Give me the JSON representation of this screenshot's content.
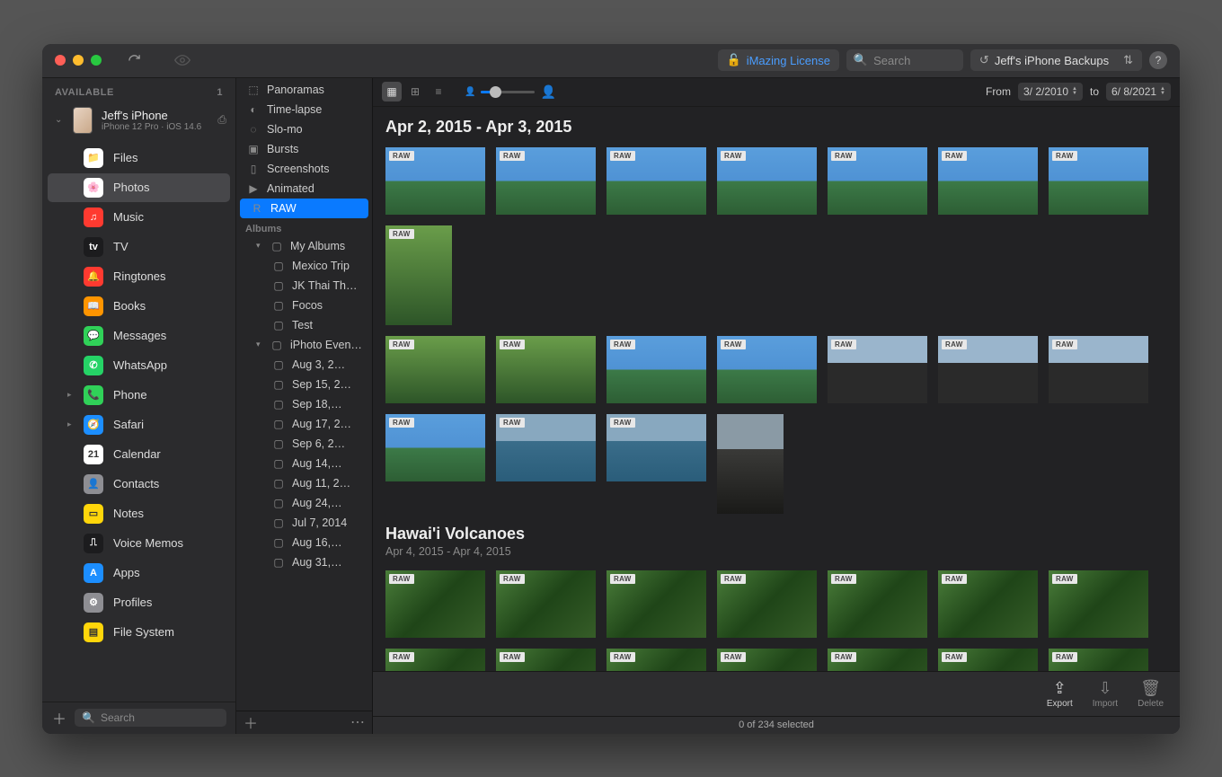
{
  "titlebar": {
    "license_label": "iMazing License",
    "search_placeholder": "Search",
    "backups_label": "Jeff's iPhone Backups",
    "help_label": "?"
  },
  "leftbar": {
    "header": "AVAILABLE",
    "count": "1",
    "device": {
      "name": "Jeff's iPhone",
      "sub": "iPhone 12 Pro · iOS 14.6"
    },
    "items": [
      {
        "label": "Files",
        "icon_bg": "#fff",
        "emoji": "📁",
        "sel": false
      },
      {
        "label": "Photos",
        "icon_bg": "#fff",
        "emoji": "🌸",
        "sel": true
      },
      {
        "label": "Music",
        "icon_bg": "#ff3a30",
        "emoji": "♫",
        "sel": false
      },
      {
        "label": "TV",
        "icon_bg": "#1c1c1e",
        "emoji": "tv",
        "sel": false
      },
      {
        "label": "Ringtones",
        "icon_bg": "#ff3a30",
        "emoji": "🔔",
        "sel": false
      },
      {
        "label": "Books",
        "icon_bg": "#ff9500",
        "emoji": "📖",
        "sel": false
      },
      {
        "label": "Messages",
        "icon_bg": "#30d158",
        "emoji": "💬",
        "sel": false
      },
      {
        "label": "WhatsApp",
        "icon_bg": "#25d366",
        "emoji": "✆",
        "sel": false
      },
      {
        "label": "Phone",
        "icon_bg": "#30d158",
        "emoji": "📞",
        "sel": false,
        "chev": true
      },
      {
        "label": "Safari",
        "icon_bg": "#1c8eff",
        "emoji": "🧭",
        "sel": false,
        "chev": true
      },
      {
        "label": "Calendar",
        "icon_bg": "#fff",
        "emoji": "21",
        "sel": false
      },
      {
        "label": "Contacts",
        "icon_bg": "#8e8e93",
        "emoji": "👤",
        "sel": false
      },
      {
        "label": "Notes",
        "icon_bg": "#ffd60a",
        "emoji": "▭",
        "sel": false
      },
      {
        "label": "Voice Memos",
        "icon_bg": "#1c1c1e",
        "emoji": "⎍",
        "sel": false
      },
      {
        "label": "Apps",
        "icon_bg": "#1c8eff",
        "emoji": "A",
        "sel": false
      },
      {
        "label": "Profiles",
        "icon_bg": "#8e8e93",
        "emoji": "⚙",
        "sel": false
      },
      {
        "label": "File System",
        "icon_bg": "#ffd60a",
        "emoji": "▤",
        "sel": false
      }
    ],
    "footer_search": "Search"
  },
  "midbar": {
    "smart": [
      {
        "label": "Panoramas",
        "ico": "⬚"
      },
      {
        "label": "Time-lapse",
        "ico": "◐"
      },
      {
        "label": "Slo-mo",
        "ico": "◌"
      },
      {
        "label": "Bursts",
        "ico": "▣"
      },
      {
        "label": "Screenshots",
        "ico": "▯"
      },
      {
        "label": "Animated",
        "ico": "▶"
      },
      {
        "label": "RAW",
        "ico": "R",
        "selected": true
      }
    ],
    "albums_header": "Albums",
    "albums": [
      {
        "label": "My Albums",
        "chev": "▾",
        "ico": "▢",
        "indent": 0
      },
      {
        "label": "Mexico Trip",
        "ico": "▢",
        "indent": 1
      },
      {
        "label": "JK Thai Th…",
        "ico": "▢",
        "indent": 1
      },
      {
        "label": "Focos",
        "ico": "▢",
        "indent": 1
      },
      {
        "label": "Test",
        "ico": "▢",
        "indent": 1
      },
      {
        "label": "iPhoto Even…",
        "chev": "▾",
        "ico": "▢",
        "indent": 0
      },
      {
        "label": "Aug 3, 2…",
        "ico": "▢",
        "indent": 1
      },
      {
        "label": "Sep 15, 2…",
        "ico": "▢",
        "indent": 1
      },
      {
        "label": "Sep 18,…",
        "ico": "▢",
        "indent": 1
      },
      {
        "label": "Aug 17, 2…",
        "ico": "▢",
        "indent": 1
      },
      {
        "label": "Sep 6, 2…",
        "ico": "▢",
        "indent": 1
      },
      {
        "label": "Aug 14,…",
        "ico": "▢",
        "indent": 1
      },
      {
        "label": "Aug 11, 2…",
        "ico": "▢",
        "indent": 1
      },
      {
        "label": "Aug 24,…",
        "ico": "▢",
        "indent": 1
      },
      {
        "label": "Jul 7, 2014",
        "ico": "▢",
        "indent": 1
      },
      {
        "label": "Aug 16,…",
        "ico": "▢",
        "indent": 1
      },
      {
        "label": "Aug 31,…",
        "ico": "▢",
        "indent": 1
      }
    ]
  },
  "main_toolbar": {
    "from_label": "From",
    "from_date": "3/  2/2010",
    "to_label": "to",
    "to_date": "6/  8/2021"
  },
  "sections": [
    {
      "title": "Apr 2, 2015 - Apr 3, 2015",
      "sub": "",
      "rows": [
        [
          {
            "c": "th-sky"
          },
          {
            "c": "th-sky"
          },
          {
            "c": "th-sky"
          },
          {
            "c": "th-sky"
          },
          {
            "c": "th-sky"
          },
          {
            "c": "th-sky"
          },
          {
            "c": "th-sky"
          },
          {
            "c": "th-green",
            "tall": true
          }
        ],
        [
          {
            "c": "th-green"
          },
          {
            "c": "th-green"
          },
          {
            "c": "th-sky"
          },
          {
            "c": "th-sky"
          },
          {
            "c": "th-car"
          },
          {
            "c": "th-car"
          },
          {
            "c": "th-car"
          }
        ],
        [
          {
            "c": "th-sky"
          },
          {
            "c": "th-sea"
          },
          {
            "c": "th-sea"
          },
          {
            "c": "th-dark",
            "tall": true,
            "noRaw": true
          }
        ]
      ]
    },
    {
      "title": "Hawai'i Volcanoes",
      "sub": "Apr 4, 2015 - Apr 4, 2015",
      "rows": [
        [
          {
            "c": "th-jungle"
          },
          {
            "c": "th-jungle"
          },
          {
            "c": "th-jungle"
          },
          {
            "c": "th-jungle"
          },
          {
            "c": "th-jungle"
          },
          {
            "c": "th-jungle"
          },
          {
            "c": "th-jungle"
          }
        ],
        [
          {
            "c": "th-jungle"
          },
          {
            "c": "th-jungle"
          },
          {
            "c": "th-jungle"
          },
          {
            "c": "th-jungle"
          },
          {
            "c": "th-jungle"
          },
          {
            "c": "th-jungle"
          },
          {
            "c": "th-jungle"
          }
        ]
      ]
    }
  ],
  "raw_badge": "RAW",
  "bottombar": {
    "actions": [
      {
        "label": "Export",
        "enabled": true
      },
      {
        "label": "Import",
        "enabled": false
      },
      {
        "label": "Delete",
        "enabled": false
      }
    ]
  },
  "status": "0 of 234 selected"
}
